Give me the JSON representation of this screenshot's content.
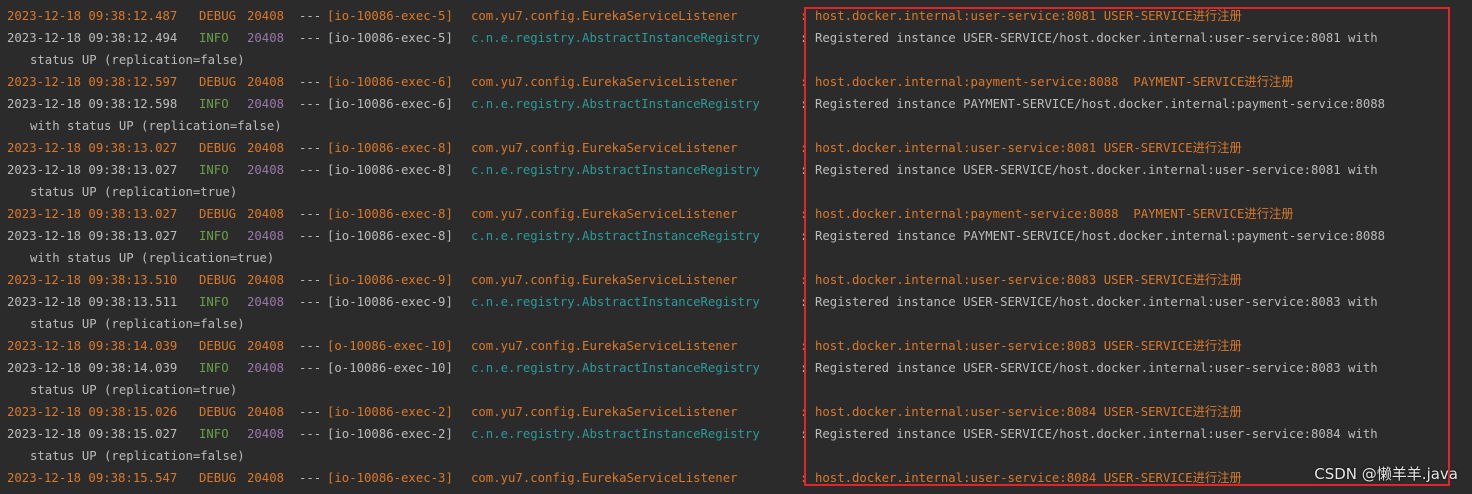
{
  "console": {
    "lines": [
      {
        "type": "debug",
        "ts": "2023-12-18 09:38:12.487",
        "level": "DEBUG",
        "pid": "20408",
        "sep": "---",
        "thread": "[io-10086-exec-5]",
        "logger": "com.yu7.config.EurekaServiceListener",
        "colon": ":",
        "msg": "host.docker.internal:user-service:8081 USER-SERVICE进行注册"
      },
      {
        "type": "info",
        "ts": "2023-12-18 09:38:12.494",
        "level": "INFO",
        "pid": "20408",
        "sep": "---",
        "thread": "[io-10086-exec-5]",
        "logger": "c.n.e.registry.AbstractInstanceRegistry",
        "colon": ":",
        "msg": "Registered instance USER-SERVICE/host.docker.internal:user-service:8081 with"
      },
      {
        "type": "cont",
        "msg": "status UP (replication=false)"
      },
      {
        "type": "debug",
        "ts": "2023-12-18 09:38:12.597",
        "level": "DEBUG",
        "pid": "20408",
        "sep": "---",
        "thread": "[io-10086-exec-6]",
        "logger": "com.yu7.config.EurekaServiceListener",
        "colon": ":",
        "msg": "host.docker.internal:payment-service:8088  PAYMENT-SERVICE进行注册"
      },
      {
        "type": "info",
        "ts": "2023-12-18 09:38:12.598",
        "level": "INFO",
        "pid": "20408",
        "sep": "---",
        "thread": "[io-10086-exec-6]",
        "logger": "c.n.e.registry.AbstractInstanceRegistry",
        "colon": ":",
        "msg": "Registered instance PAYMENT-SERVICE/host.docker.internal:payment-service:8088"
      },
      {
        "type": "cont",
        "msg": "with status UP (replication=false)"
      },
      {
        "type": "debug",
        "ts": "2023-12-18 09:38:13.027",
        "level": "DEBUG",
        "pid": "20408",
        "sep": "---",
        "thread": "[io-10086-exec-8]",
        "logger": "com.yu7.config.EurekaServiceListener",
        "colon": ":",
        "msg": "host.docker.internal:user-service:8081 USER-SERVICE进行注册"
      },
      {
        "type": "info",
        "ts": "2023-12-18 09:38:13.027",
        "level": "INFO",
        "pid": "20408",
        "sep": "---",
        "thread": "[io-10086-exec-8]",
        "logger": "c.n.e.registry.AbstractInstanceRegistry",
        "colon": ":",
        "msg": "Registered instance USER-SERVICE/host.docker.internal:user-service:8081 with"
      },
      {
        "type": "cont",
        "msg": "status UP (replication=true)"
      },
      {
        "type": "debug",
        "ts": "2023-12-18 09:38:13.027",
        "level": "DEBUG",
        "pid": "20408",
        "sep": "---",
        "thread": "[io-10086-exec-8]",
        "logger": "com.yu7.config.EurekaServiceListener",
        "colon": ":",
        "msg": "host.docker.internal:payment-service:8088  PAYMENT-SERVICE进行注册"
      },
      {
        "type": "info",
        "ts": "2023-12-18 09:38:13.027",
        "level": "INFO",
        "pid": "20408",
        "sep": "---",
        "thread": "[io-10086-exec-8]",
        "logger": "c.n.e.registry.AbstractInstanceRegistry",
        "colon": ":",
        "msg": "Registered instance PAYMENT-SERVICE/host.docker.internal:payment-service:8088"
      },
      {
        "type": "cont",
        "msg": "with status UP (replication=true)"
      },
      {
        "type": "debug",
        "ts": "2023-12-18 09:38:13.510",
        "level": "DEBUG",
        "pid": "20408",
        "sep": "---",
        "thread": "[io-10086-exec-9]",
        "logger": "com.yu7.config.EurekaServiceListener",
        "colon": ":",
        "msg": "host.docker.internal:user-service:8083 USER-SERVICE进行注册"
      },
      {
        "type": "info",
        "ts": "2023-12-18 09:38:13.511",
        "level": "INFO",
        "pid": "20408",
        "sep": "---",
        "thread": "[io-10086-exec-9]",
        "logger": "c.n.e.registry.AbstractInstanceRegistry",
        "colon": ":",
        "msg": "Registered instance USER-SERVICE/host.docker.internal:user-service:8083 with"
      },
      {
        "type": "cont",
        "msg": "status UP (replication=false)"
      },
      {
        "type": "debug",
        "ts": "2023-12-18 09:38:14.039",
        "level": "DEBUG",
        "pid": "20408",
        "sep": "---",
        "thread": "[o-10086-exec-10]",
        "logger": "com.yu7.config.EurekaServiceListener",
        "colon": ":",
        "msg": "host.docker.internal:user-service:8083 USER-SERVICE进行注册"
      },
      {
        "type": "info",
        "ts": "2023-12-18 09:38:14.039",
        "level": "INFO",
        "pid": "20408",
        "sep": "---",
        "thread": "[o-10086-exec-10]",
        "logger": "c.n.e.registry.AbstractInstanceRegistry",
        "colon": ":",
        "msg": "Registered instance USER-SERVICE/host.docker.internal:user-service:8083 with"
      },
      {
        "type": "cont",
        "msg": "status UP (replication=true)"
      },
      {
        "type": "debug",
        "ts": "2023-12-18 09:38:15.026",
        "level": "DEBUG",
        "pid": "20408",
        "sep": "---",
        "thread": "[io-10086-exec-2]",
        "logger": "com.yu7.config.EurekaServiceListener",
        "colon": ":",
        "msg": "host.docker.internal:user-service:8084 USER-SERVICE进行注册"
      },
      {
        "type": "info",
        "ts": "2023-12-18 09:38:15.027",
        "level": "INFO",
        "pid": "20408",
        "sep": "---",
        "thread": "[io-10086-exec-2]",
        "logger": "c.n.e.registry.AbstractInstanceRegistry",
        "colon": ":",
        "msg": "Registered instance USER-SERVICE/host.docker.internal:user-service:8084 with"
      },
      {
        "type": "cont",
        "msg": "status UP (replication=false)"
      },
      {
        "type": "debug",
        "ts": "2023-12-18 09:38:15.547",
        "level": "DEBUG",
        "pid": "20408",
        "sep": "---",
        "thread": "[io-10086-exec-3]",
        "logger": "com.yu7.config.EurekaServiceListener",
        "colon": ":",
        "msg": "host.docker.internal:user-service:8084 USER-SERVICE进行注册"
      }
    ]
  },
  "watermark": "CSDN @懒羊羊.java",
  "colors": {
    "background": "#2b2b2b",
    "debug": "#d9792a",
    "info_level": "#6a9e4a",
    "pid": "#9877a9",
    "logger_info": "#2c9a9a",
    "highlight_border": "#e0262a"
  }
}
